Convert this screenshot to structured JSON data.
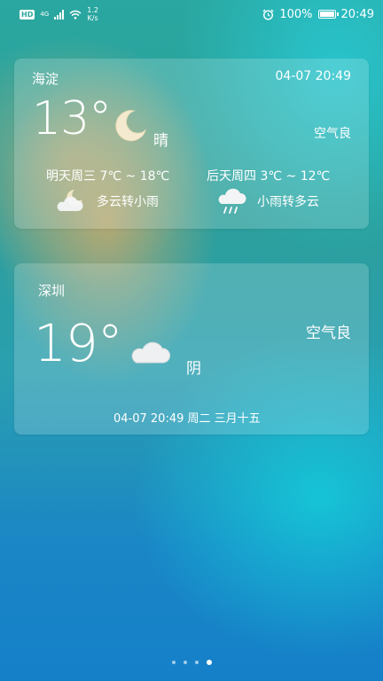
{
  "status_bar": {
    "hd": "HD",
    "network": "4G",
    "speed_value": "1.2",
    "speed_unit": "K/s",
    "battery": "100%",
    "time": "20:49"
  },
  "card1": {
    "city": "海淀",
    "datetime": "04-07 20:49",
    "temperature": "13°",
    "condition": "晴",
    "condition_icon": "moon-icon",
    "air_quality": "空气良",
    "forecast": [
      {
        "label": "明天周三   7℃ ~ 18℃",
        "desc": "多云转小雨",
        "icon": "partly-cloudy-night-icon"
      },
      {
        "label": "后天周四   3℃ ~ 12℃",
        "desc": "小雨转多云",
        "icon": "rain-cloud-icon"
      }
    ]
  },
  "card2": {
    "city": "深圳",
    "temperature": "19°",
    "condition": "阴",
    "condition_icon": "cloud-icon",
    "air_quality": "空气良",
    "date_line": "04-07 20:49   周二   三月十五"
  },
  "pager": {
    "count": 4,
    "active_index": 3
  }
}
